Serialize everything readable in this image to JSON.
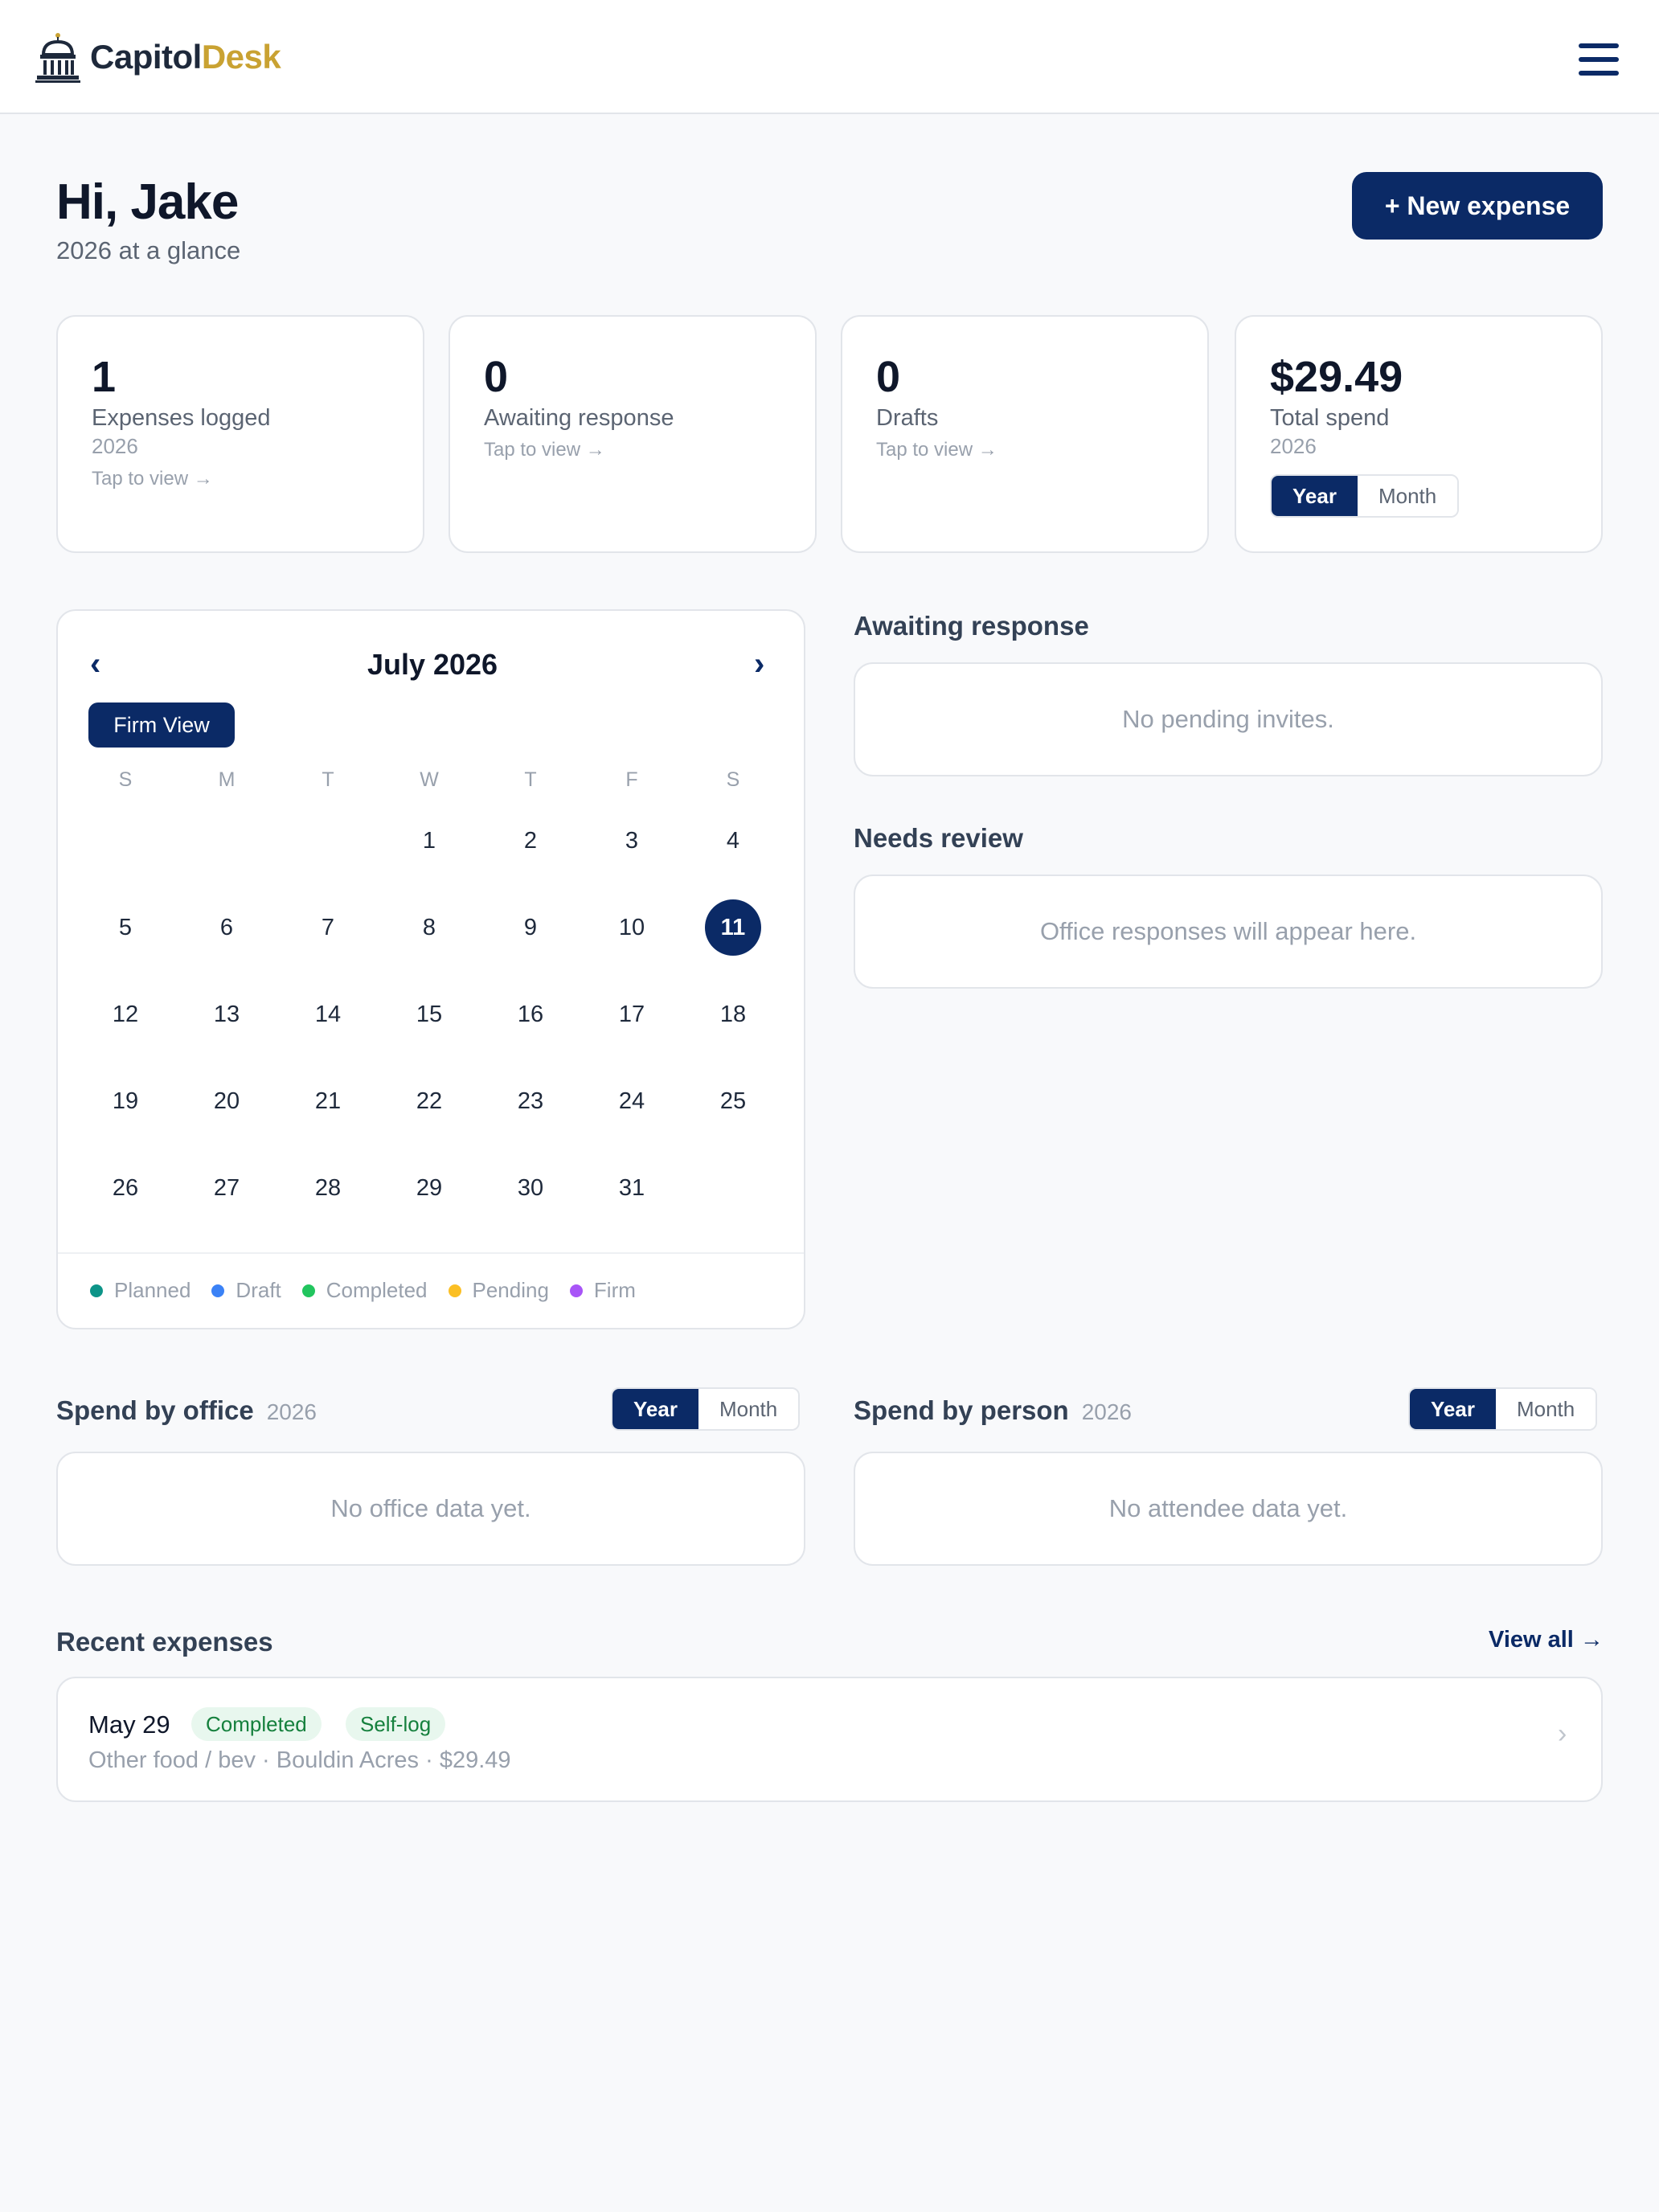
{
  "brand": {
    "name_part1": "Capitol",
    "name_part2": "Desk"
  },
  "header": {
    "greeting": "Hi, Jake",
    "subtitle": "2026 at a glance",
    "new_expense_label": "+ New expense"
  },
  "stats": [
    {
      "value": "1",
      "label": "Expenses logged",
      "year": "2026",
      "link": "Tap to view →"
    },
    {
      "value": "0",
      "label": "Awaiting response",
      "link": "Tap to view →"
    },
    {
      "value": "0",
      "label": "Drafts",
      "link": "Tap to view →"
    },
    {
      "value": "$29.49",
      "label": "Total spend",
      "year": "2026",
      "toggle": [
        "Year",
        "Month"
      ]
    }
  ],
  "calendar": {
    "month_title": "July 2026",
    "firm_view_label": "Firm View",
    "prev_icon": "chevron-left-icon",
    "next_icon": "chevron-right-icon",
    "weekdays": [
      "S",
      "M",
      "T",
      "W",
      "T",
      "F",
      "S"
    ],
    "first_weekday_index": 3,
    "days_in_month": 31,
    "selected_day": 11,
    "legend": [
      {
        "label": "Planned",
        "color": "#0d9488"
      },
      {
        "label": "Draft",
        "color": "#3b82f6"
      },
      {
        "label": "Completed",
        "color": "#22c55e"
      },
      {
        "label": "Pending",
        "color": "#fbbf24"
      },
      {
        "label": "Firm",
        "color": "#a855f7"
      }
    ]
  },
  "awaiting": {
    "title": "Awaiting response",
    "empty": "No pending invites."
  },
  "review": {
    "title": "Needs review",
    "empty": "Office responses will appear here."
  },
  "spend_office": {
    "title": "Spend by office",
    "year": "2026",
    "toggle": [
      "Year",
      "Month"
    ],
    "empty": "No office data yet."
  },
  "spend_person": {
    "title": "Spend by person",
    "year": "2026",
    "toggle": [
      "Year",
      "Month"
    ],
    "empty": "No attendee data yet."
  },
  "recent": {
    "title": "Recent expenses",
    "view_all": "View all →",
    "items": [
      {
        "date": "May 29",
        "status": "Completed",
        "type": "Self-log",
        "description": "Other food / bev · Bouldin Acres · $29.49"
      }
    ]
  },
  "colors": {
    "primary": "#0b2a66",
    "gold": "#c9a232"
  }
}
